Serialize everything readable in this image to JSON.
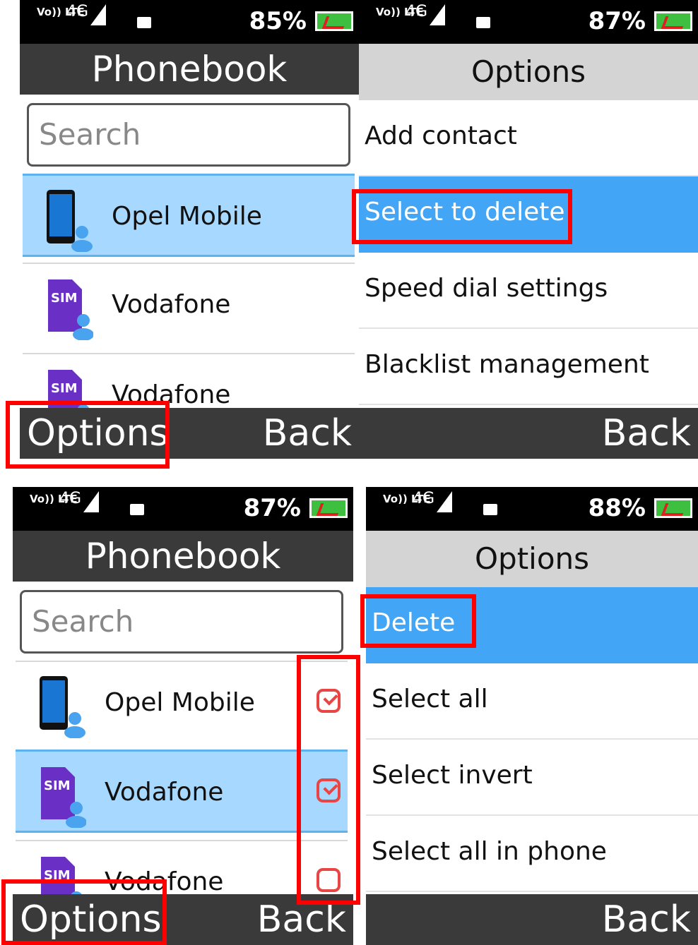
{
  "status_bars": [
    {
      "network": "4G",
      "battery_percent": "85%"
    },
    {
      "network": "4G",
      "battery_percent": "87%"
    },
    {
      "network": "4G",
      "battery_percent": "87%"
    },
    {
      "network": "4G",
      "battery_percent": "88%"
    }
  ],
  "status_common": {
    "volte_label": "Vo)) LTE",
    "sim_signal_label": "4G"
  },
  "phonebook_top": {
    "title": "Phonebook",
    "search_placeholder": "Search",
    "contacts": [
      {
        "name": "Opel Mobile",
        "icon": "phone-contact-icon",
        "selected": true
      },
      {
        "name": "Vodafone",
        "icon": "sim-contact-icon",
        "selected": false
      },
      {
        "name": "Vodafone",
        "icon": "sim-contact-icon",
        "selected": false
      }
    ],
    "softkey_left": "Options",
    "softkey_right": "Back"
  },
  "options_top": {
    "title": "Options",
    "items": [
      "Add contact",
      "Select to delete",
      "Speed dial settings",
      "Blacklist management"
    ],
    "selected_index": 1,
    "softkey_right": "Back"
  },
  "phonebook_bottom": {
    "title": "Phonebook",
    "search_placeholder": "Search",
    "contacts": [
      {
        "name": "Opel Mobile",
        "icon": "phone-contact-icon",
        "checked": true
      },
      {
        "name": "Vodafone",
        "icon": "sim-contact-icon",
        "checked": true
      },
      {
        "name": "Vodafone",
        "icon": "sim-contact-icon",
        "checked": false
      }
    ],
    "highlighted_index": 1,
    "softkey_left": "Options",
    "softkey_right": "Back"
  },
  "options_bottom": {
    "title": "Options",
    "items": [
      "Delete",
      "Select all",
      "Select invert",
      "Select all in phone"
    ],
    "selected_index": 0,
    "softkey_right": "Back"
  },
  "colors": {
    "highlight_row": "#a7d8ff",
    "menu_selected": "#42a5f5",
    "bar_dark": "#3a3a3a",
    "annotation_red": "#ff0000"
  }
}
